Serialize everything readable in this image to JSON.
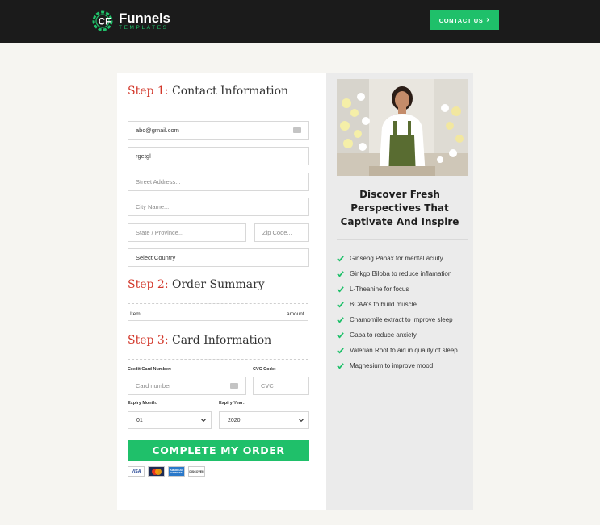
{
  "header": {
    "logo_title": "Funnels",
    "logo_subtitle": "TEMPLATES",
    "contact_button": "CONTACT US",
    "contact_arrow": "›"
  },
  "step1": {
    "num": "Step 1:",
    "title": "Contact Information",
    "email_value": "abc@gmail.com",
    "name_value": "rgetgl",
    "street_placeholder": "Street Address...",
    "city_placeholder": "City Name...",
    "state_placeholder": "State / Province...",
    "zip_placeholder": "Zip Code...",
    "country_value": "Select Country"
  },
  "step2": {
    "num": "Step 2:",
    "title": "Order Summary",
    "col_item": "Item",
    "col_amount": "amount"
  },
  "step3": {
    "num": "Step 3:",
    "title": "Card Information",
    "card_label": "Credit Card Number:",
    "card_placeholder": "Card number",
    "cvc_label": "CVC Code:",
    "cvc_placeholder": "CVC",
    "month_label": "Expiry Month:",
    "month_value": "01",
    "year_label": "Expiry Year:",
    "year_value": "2020"
  },
  "order_button": "COMPLETE MY ORDER",
  "cards": [
    "VISA",
    "mastercard",
    "AMERICAN EXPRESS",
    "DISCOVER"
  ],
  "sidebar": {
    "headline": "Discover Fresh Perspectives That Captivate And Inspire",
    "benefits": [
      "Ginseng Panax for mental acuity",
      "Ginkgo Biloba to reduce inflamation",
      "L-Theanine for focus",
      "BCAA's to build muscle",
      "Chamomile extract to improve sleep",
      "Gaba to reduce anxiety",
      "Valerian Root to aid in quality of sleep",
      "Magnesium to improve mood"
    ]
  },
  "colors": {
    "accent_green": "#1fc06a",
    "step_red": "#d2372a",
    "header_bg": "#1b1b1b"
  }
}
